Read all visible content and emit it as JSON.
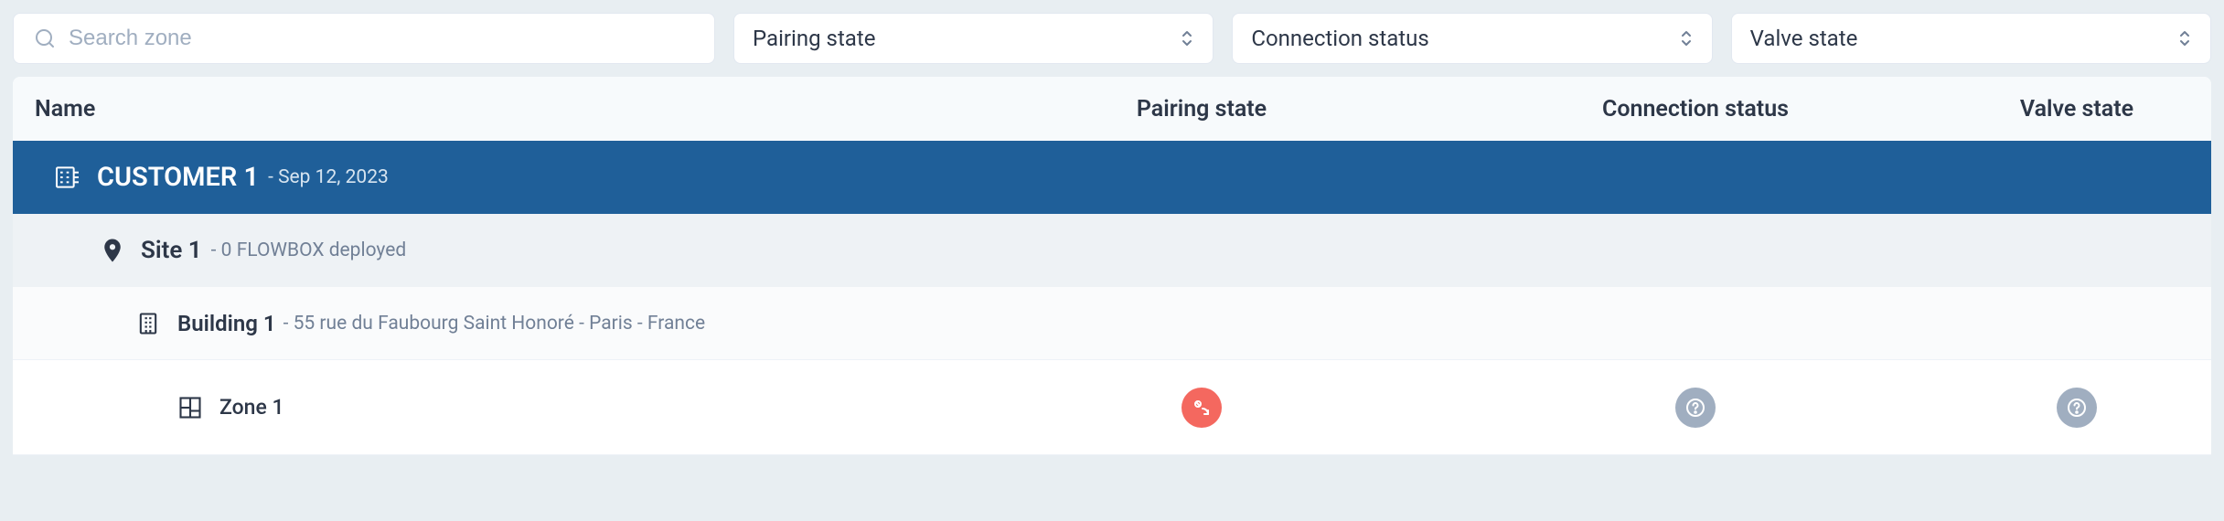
{
  "filters": {
    "search": {
      "placeholder": "Search zone",
      "value": ""
    },
    "pairing_state": {
      "label": "Pairing state"
    },
    "connection_status": {
      "label": "Connection status"
    },
    "valve_state": {
      "label": "Valve state"
    }
  },
  "table": {
    "headers": {
      "name": "Name",
      "pairing": "Pairing state",
      "connection": "Connection status",
      "valve": "Valve state"
    },
    "rows": {
      "customer": {
        "name": "CUSTOMER 1",
        "meta": "- Sep 12, 2023"
      },
      "site": {
        "name": "Site 1",
        "meta": "- 0 FLOWBOX deployed"
      },
      "building": {
        "name": "Building 1",
        "meta": "- 55 rue du Faubourg Saint Honoré - Paris - France"
      },
      "zone": {
        "name": "Zone 1",
        "pairing_status": "error",
        "connection_status": "unknown",
        "valve_status": "unknown"
      }
    }
  }
}
